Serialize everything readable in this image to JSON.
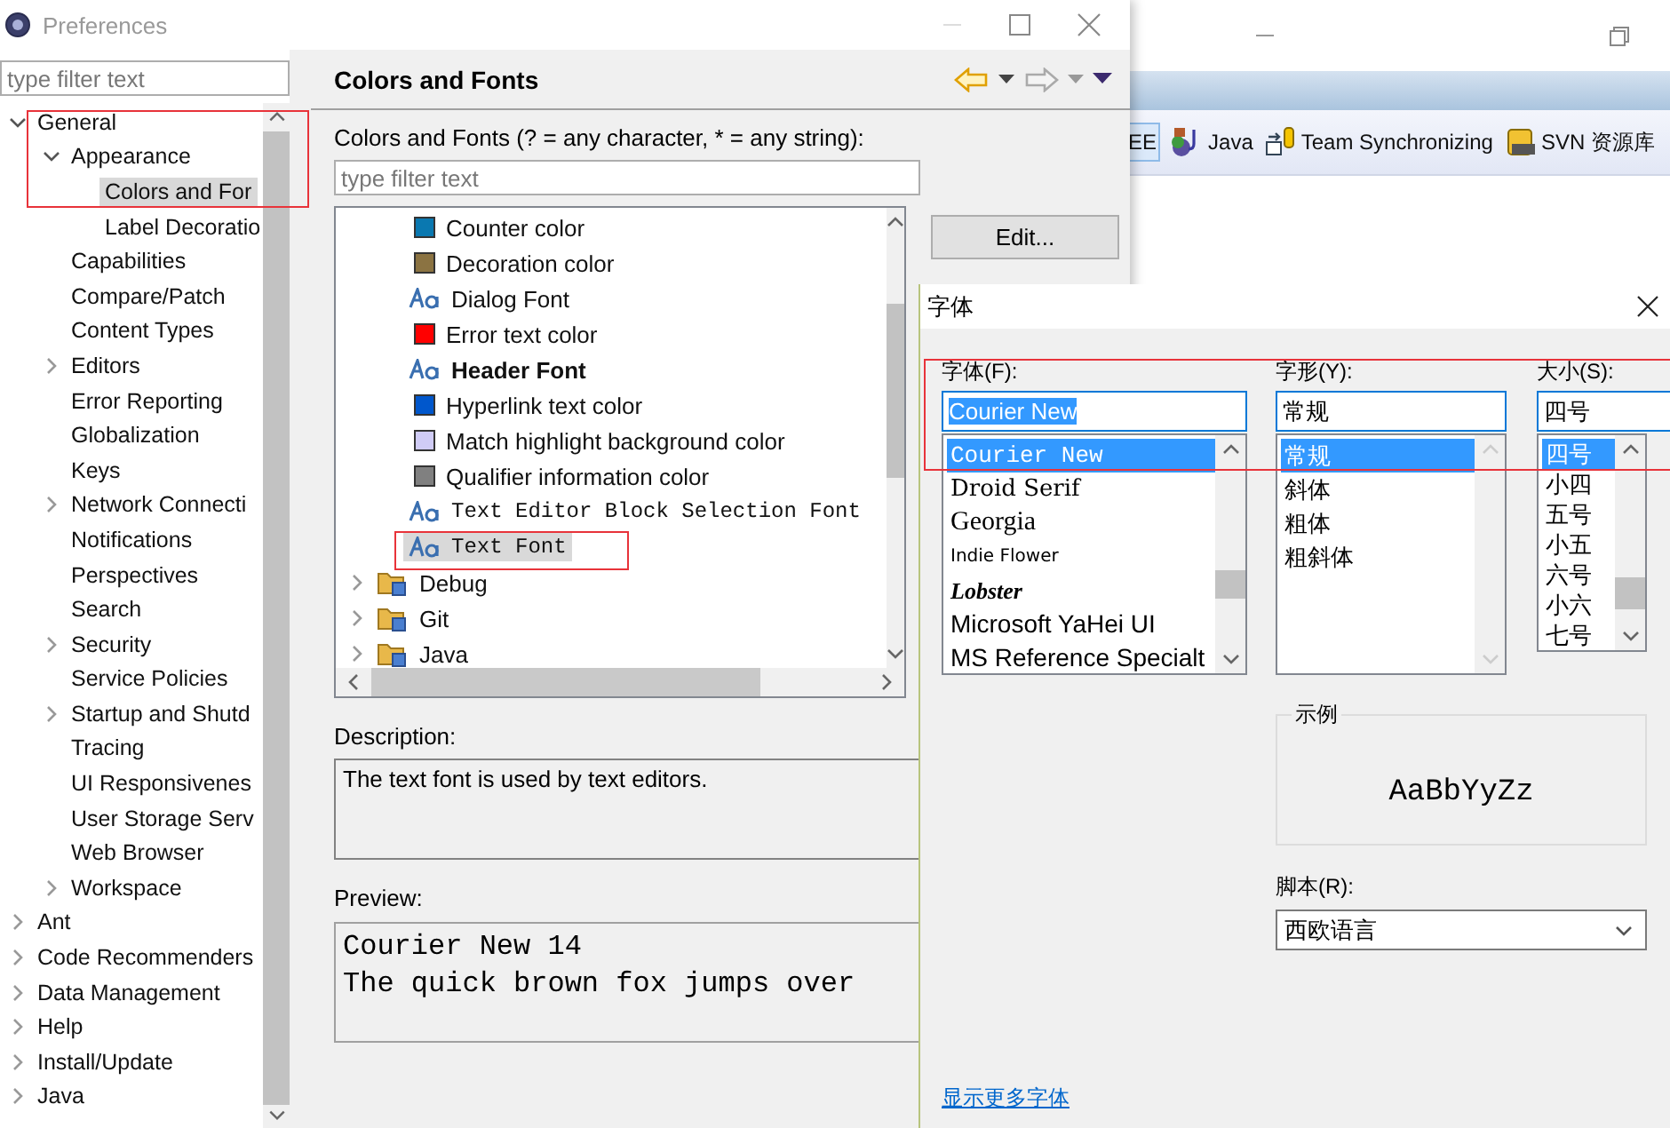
{
  "background_window": {
    "perspectives": [
      {
        "label": "EE",
        "selected": true
      },
      {
        "label": "Java",
        "selected": false
      },
      {
        "label": "Team Synchronizing",
        "selected": false
      },
      {
        "label": "SVN 资源库",
        "selected": false
      }
    ]
  },
  "preferences": {
    "title": "Preferences",
    "filter": {
      "placeholder": "type filter text"
    },
    "tree_annotated": true,
    "tree": [
      {
        "label": "General",
        "expanded": true,
        "selected": false,
        "children": [
          {
            "label": "Appearance",
            "expanded": true,
            "selected": false,
            "children": [
              {
                "label": "Colors and For",
                "selected": true
              },
              {
                "label": "Label Decoratio",
                "selected": false
              }
            ]
          },
          {
            "label": "Capabilities",
            "selected": false
          },
          {
            "label": "Compare/Patch",
            "selected": false
          },
          {
            "label": "Content Types",
            "selected": false
          },
          {
            "label": "Editors",
            "expanded": false,
            "selected": false
          },
          {
            "label": "Error Reporting",
            "selected": false
          },
          {
            "label": "Globalization",
            "selected": false
          },
          {
            "label": "Keys",
            "selected": false
          },
          {
            "label": "Network Connecti",
            "expanded": false,
            "selected": false
          },
          {
            "label": "Notifications",
            "selected": false
          },
          {
            "label": "Perspectives",
            "selected": false
          },
          {
            "label": "Search",
            "selected": false
          },
          {
            "label": "Security",
            "expanded": false,
            "selected": false
          },
          {
            "label": "Service Policies",
            "selected": false
          },
          {
            "label": "Startup and Shutd",
            "expanded": false,
            "selected": false
          },
          {
            "label": "Tracing",
            "selected": false
          },
          {
            "label": "UI Responsivenes",
            "selected": false
          },
          {
            "label": "User Storage Serv",
            "selected": false
          },
          {
            "label": "Web Browser",
            "selected": false
          },
          {
            "label": "Workspace",
            "expanded": false,
            "selected": false
          }
        ]
      },
      {
        "label": "Ant",
        "expanded": false,
        "selected": false
      },
      {
        "label": "Code Recommenders",
        "expanded": false,
        "selected": false
      },
      {
        "label": "Data Management",
        "expanded": false,
        "selected": false
      },
      {
        "label": "Help",
        "expanded": false,
        "selected": false
      },
      {
        "label": "Install/Update",
        "expanded": false,
        "selected": false
      },
      {
        "label": "Java",
        "expanded": false,
        "selected": false
      }
    ],
    "page": {
      "title": "Colors and Fonts",
      "filter_label": "Colors and Fonts (? = any character, * = any string):",
      "filter": {
        "placeholder": "type filter text"
      },
      "list_annotated": true,
      "items": [
        {
          "kind": "color",
          "label": "Counter color",
          "color": "#0a78b0",
          "selected": false
        },
        {
          "kind": "color",
          "label": "Decoration color",
          "color": "#8b7342",
          "selected": false
        },
        {
          "kind": "font",
          "label": "Dialog Font",
          "selected": false
        },
        {
          "kind": "color",
          "label": "Error text color",
          "color": "#ff0000",
          "selected": false
        },
        {
          "kind": "font",
          "label": "Header Font",
          "selected": false
        },
        {
          "kind": "color",
          "label": "Hyperlink text color",
          "color": "#0057cc",
          "selected": false
        },
        {
          "kind": "color",
          "label": "Match highlight background color",
          "color": "#d0ccf6",
          "selected": false
        },
        {
          "kind": "color",
          "label": "Qualifier information color",
          "color": "#808080",
          "selected": false
        },
        {
          "kind": "font",
          "label": "Text Editor Block Selection Font",
          "selected": false
        },
        {
          "kind": "font",
          "label": "Text Font",
          "selected": true
        },
        {
          "kind": "category",
          "label": "Debug",
          "expanded": false,
          "selected": false
        },
        {
          "kind": "category",
          "label": "Git",
          "expanded": false,
          "selected": false
        },
        {
          "kind": "category",
          "label": "Java",
          "expanded": false,
          "selected": false
        }
      ],
      "buttons": [
        "Edit..."
      ],
      "description_label": "Description:",
      "description": "The text font is used by text editors.",
      "preview_label": "Preview:",
      "preview_lines": [
        "Courier New 14",
        "The quick brown fox jumps over"
      ]
    }
  },
  "font_dialog": {
    "title": "字体",
    "annotated": true,
    "font": {
      "label": "字体(F):",
      "value": "Courier New",
      "value_selected": true,
      "options": [
        {
          "label": "Courier New",
          "selected": true
        },
        {
          "label": "Droid Serif",
          "selected": false
        },
        {
          "label": "Georgia",
          "selected": false
        },
        {
          "label": "Indie Flower",
          "selected": false
        },
        {
          "label": "Lobster",
          "selected": false
        },
        {
          "label": "Microsoft YaHei UI",
          "selected": false
        },
        {
          "label": "MS Reference Specialt",
          "selected": false
        }
      ]
    },
    "style": {
      "label": "字形(Y):",
      "value": "常规",
      "value_selected": false,
      "options": [
        {
          "label": "常规",
          "selected": true
        },
        {
          "label": "斜体",
          "selected": false
        },
        {
          "label": "粗体",
          "selected": false
        },
        {
          "label": "粗斜体",
          "selected": false
        }
      ]
    },
    "size": {
      "label": "大小(S):",
      "value": "四号",
      "value_selected": false,
      "options": [
        {
          "label": "四号",
          "selected": true
        },
        {
          "label": "小四",
          "selected": false
        },
        {
          "label": "五号",
          "selected": false
        },
        {
          "label": "小五",
          "selected": false
        },
        {
          "label": "六号",
          "selected": false
        },
        {
          "label": "小六",
          "selected": false
        },
        {
          "label": "七号",
          "selected": false
        }
      ]
    },
    "sample": {
      "label": "示例",
      "text": "AaBbYyZz"
    },
    "script": {
      "label": "脚本(R):",
      "value": "西欧语言"
    },
    "more_fonts_link": "显示更多字体"
  }
}
